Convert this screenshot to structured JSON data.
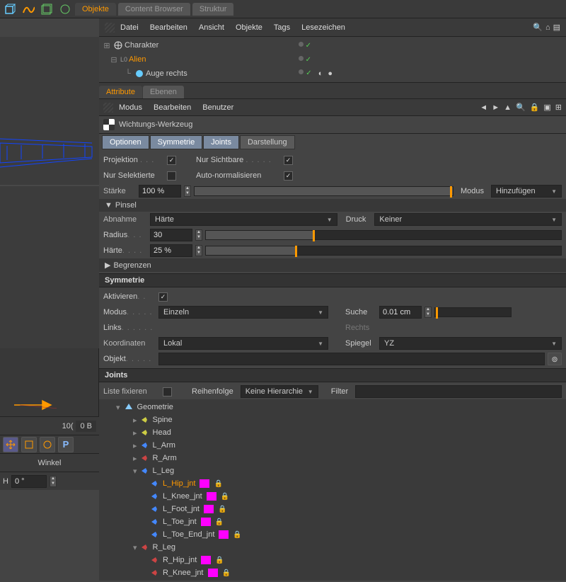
{
  "topTabs": {
    "objekte": "Objekte",
    "content": "Content Browser",
    "struktur": "Struktur"
  },
  "topMenu": {
    "datei": "Datei",
    "bearbeiten": "Bearbeiten",
    "ansicht": "Ansicht",
    "objekte": "Objekte",
    "tags": "Tags",
    "lesezeichen": "Lesezeichen"
  },
  "hierarchy": {
    "charakter": "Charakter",
    "alien": "Alien",
    "auge": "Auge rechts"
  },
  "attrTabs": {
    "attribute": "Attribute",
    "ebenen": "Ebenen"
  },
  "attrMenu": {
    "modus": "Modus",
    "bearbeiten": "Bearbeiten",
    "benutzer": "Benutzer"
  },
  "toolName": "Wichtungs-Werkzeug",
  "optTabs": {
    "optionen": "Optionen",
    "symmetrie": "Symmetrie",
    "joints": "Joints",
    "darstellung": "Darstellung"
  },
  "props": {
    "projektion": "Projektion",
    "nurSichtbare": "Nur Sichtbare",
    "nurSelektierte": "Nur Selektierte",
    "autoNorm": "Auto-normalisieren",
    "staerke": "Stärke",
    "staerkeVal": "100 %",
    "modus": "Modus",
    "modusVal": "Hinzufügen",
    "pinsel": "Pinsel",
    "abnahme": "Abnahme",
    "abnahmeVal": "Härte",
    "druck": "Druck",
    "druckVal": "Keiner",
    "radius": "Radius",
    "radiusVal": "30",
    "haerte": "Härte",
    "haerteVal": "25 %",
    "begrenzen": "Begrenzen"
  },
  "symmetrie": {
    "title": "Symmetrie",
    "aktivieren": "Aktivieren",
    "modus": "Modus",
    "modusVal": "Einzeln",
    "suche": "Suche",
    "sucheVal": "0.01 cm",
    "links": "Links",
    "rechts": "Rechts",
    "koordinaten": "Koordinaten",
    "koordVal": "Lokal",
    "spiegel": "Spiegel",
    "spiegelVal": "YZ",
    "objekt": "Objekt"
  },
  "joints": {
    "title": "Joints",
    "listeFixieren": "Liste fixieren",
    "reihenfolge": "Reihenfolge",
    "reihenfolgeVal": "Keine Hierarchie",
    "filter": "Filter",
    "items": [
      {
        "n": "Geometrie",
        "d": 0,
        "t": "geo"
      },
      {
        "n": "Spine",
        "d": 1,
        "c": "#cc4"
      },
      {
        "n": "Head",
        "d": 1,
        "c": "#cc4"
      },
      {
        "n": "L_Arm",
        "d": 1,
        "c": "#48f"
      },
      {
        "n": "R_Arm",
        "d": 1,
        "c": "#c44"
      },
      {
        "n": "L_Leg",
        "d": 1,
        "c": "#48f",
        "exp": true
      },
      {
        "n": "L_Hip_jnt",
        "d": 2,
        "c": "#48f",
        "sw": true,
        "sel": true
      },
      {
        "n": "L_Knee_jnt",
        "d": 2,
        "c": "#48f",
        "sw": true
      },
      {
        "n": "L_Foot_jnt",
        "d": 2,
        "c": "#48f",
        "sw": true
      },
      {
        "n": "L_Toe_jnt",
        "d": 2,
        "c": "#48f",
        "sw": true
      },
      {
        "n": "L_Toe_End_jnt",
        "d": 2,
        "c": "#48f",
        "sw": true
      },
      {
        "n": "R_Leg",
        "d": 1,
        "c": "#c44",
        "exp": true
      },
      {
        "n": "R_Hip_jnt",
        "d": 2,
        "c": "#c44",
        "sw": true
      },
      {
        "n": "R_Knee_jnt",
        "d": 2,
        "c": "#c44",
        "sw": true
      }
    ]
  },
  "bottom": {
    "zero": "0",
    "b": "0 B",
    "ten": "10(",
    "winkel": "Winkel",
    "h": "H",
    "hval": "0 °"
  },
  "colors": {
    "accent": "#f90",
    "magenta": "#f0f"
  }
}
